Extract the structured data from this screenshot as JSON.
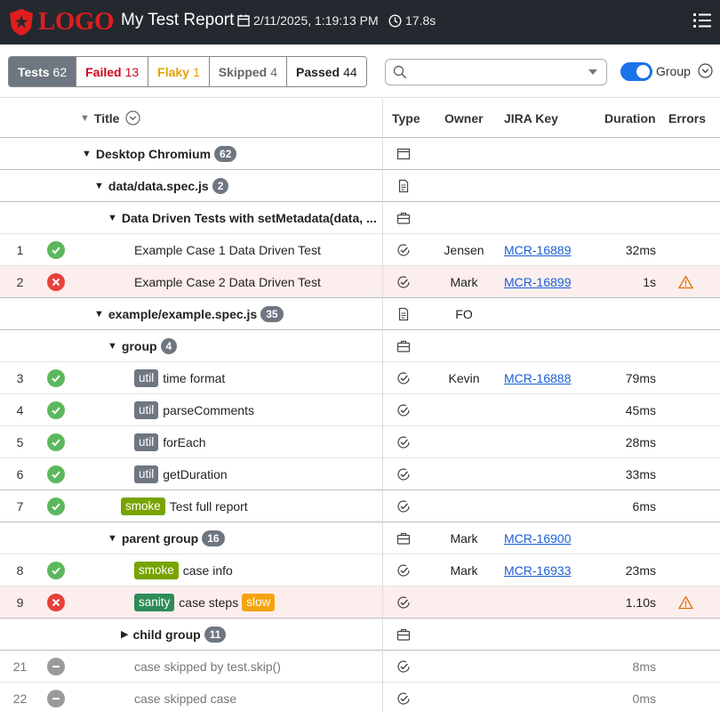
{
  "header": {
    "logo_text": "LOGO",
    "title": "My Test Report",
    "date": "2/11/2025, 1:19:13 PM",
    "duration": "17.8s"
  },
  "tabs": [
    {
      "label": "Tests",
      "count": "62",
      "kind": "active"
    },
    {
      "label": "Failed",
      "count": "13",
      "kind": "failed"
    },
    {
      "label": "Flaky",
      "count": "1",
      "kind": "flaky"
    },
    {
      "label": "Skipped",
      "count": "4",
      "kind": "skipped"
    },
    {
      "label": "Passed",
      "count": "44",
      "kind": "passed"
    }
  ],
  "search": {
    "placeholder": ""
  },
  "group_toggle": {
    "label": "Group",
    "on": true
  },
  "columns": {
    "title": "Title",
    "type": "Type",
    "owner": "Owner",
    "jira": "JIRA Key",
    "duration": "Duration",
    "errors": "Errors"
  },
  "rows": [
    {
      "kind": "group",
      "level": 1,
      "title": "Desktop Chromium",
      "count": "62",
      "type": "project",
      "expanded": true,
      "sep": true
    },
    {
      "kind": "group",
      "level": 2,
      "title": "data/data.spec.js",
      "count": "2",
      "type": "file",
      "expanded": true,
      "sep": true
    },
    {
      "kind": "group",
      "level": 3,
      "title": "Data Driven Tests with setMetadata(data, ...",
      "count": "",
      "type": "suite",
      "expanded": true,
      "sep": false
    },
    {
      "kind": "case",
      "num": "1",
      "status": "passed",
      "level": 4,
      "title": "Example Case 1 Data Driven Test",
      "owner": "Jensen",
      "jira": "MCR-16889",
      "duration": "32ms"
    },
    {
      "kind": "case",
      "num": "2",
      "status": "failed",
      "level": 4,
      "title": "Example Case 2 Data Driven Test",
      "owner": "Mark",
      "jira": "MCR-16899",
      "duration": "1s",
      "error": true,
      "sep": true
    },
    {
      "kind": "group",
      "level": 2,
      "title": "example/example.spec.js",
      "count": "35",
      "type": "file",
      "expanded": true,
      "owner": "FO",
      "sep": true
    },
    {
      "kind": "group",
      "level": 3,
      "title": "group",
      "count": "4",
      "type": "suite",
      "expanded": true
    },
    {
      "kind": "case",
      "num": "3",
      "status": "passed",
      "level": 4,
      "tags": [
        "util"
      ],
      "title": "time format",
      "owner": "Kevin",
      "jira": "MCR-16888",
      "duration": "79ms"
    },
    {
      "kind": "case",
      "num": "4",
      "status": "passed",
      "level": 4,
      "tags": [
        "util"
      ],
      "title": "parseComments",
      "duration": "45ms"
    },
    {
      "kind": "case",
      "num": "5",
      "status": "passed",
      "level": 4,
      "tags": [
        "util"
      ],
      "title": "forEach",
      "duration": "28ms"
    },
    {
      "kind": "case",
      "num": "6",
      "status": "passed",
      "level": 4,
      "tags": [
        "util"
      ],
      "title": "getDuration",
      "duration": "33ms",
      "sep": true
    },
    {
      "kind": "case",
      "num": "7",
      "status": "passed",
      "level": 3,
      "tags": [
        "smoke"
      ],
      "title": "Test full report",
      "duration": "6ms",
      "sep": true
    },
    {
      "kind": "group",
      "level": 3,
      "title": "parent group",
      "count": "16",
      "type": "suite",
      "expanded": true,
      "owner": "Mark",
      "jira": "MCR-16900"
    },
    {
      "kind": "case",
      "num": "8",
      "status": "passed",
      "level": 4,
      "tags": [
        "smoke"
      ],
      "title": "case info",
      "owner": "Mark",
      "jira": "MCR-16933",
      "duration": "23ms"
    },
    {
      "kind": "case",
      "num": "9",
      "status": "failed",
      "level": 4,
      "tags": [
        "sanity"
      ],
      "title": "case steps",
      "suffix_tags": [
        "slow"
      ],
      "duration": "1.10s",
      "error": true,
      "sep": true
    },
    {
      "kind": "group",
      "level": 4,
      "title": "child group",
      "count": "11",
      "type": "suite",
      "expanded": false,
      "sep": true
    },
    {
      "kind": "case",
      "num": "21",
      "status": "skipped",
      "level": 4,
      "title": "case skipped by test.skip()",
      "duration": "8ms"
    },
    {
      "kind": "case",
      "num": "22",
      "status": "skipped",
      "level": 4,
      "title": "case skipped case",
      "duration": "0ms"
    }
  ],
  "colors": {
    "header_bg": "#24292f",
    "logo": "#e01e1e",
    "passed": "#5cb85c",
    "failed": "#e8403a",
    "skipped": "#9a9a9a",
    "link": "#1a5fd6",
    "warning": "#e07000"
  }
}
